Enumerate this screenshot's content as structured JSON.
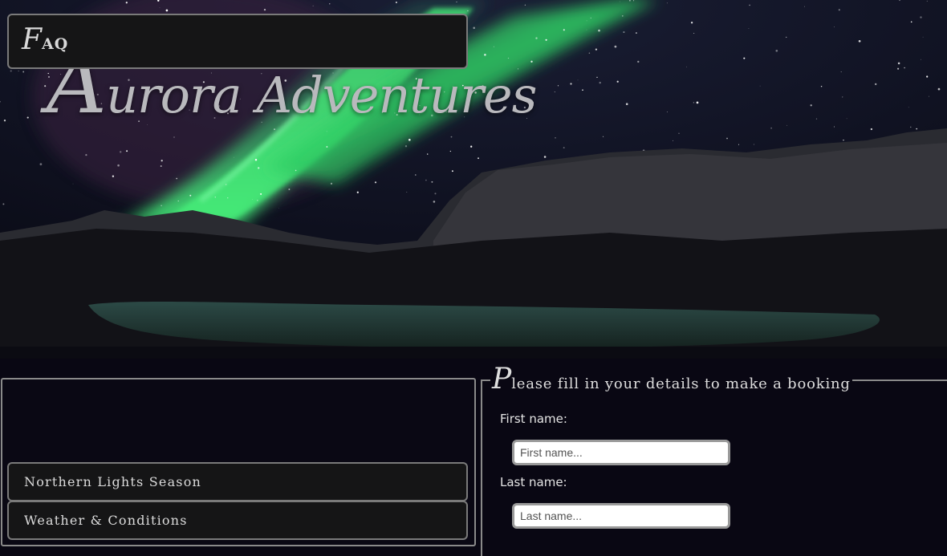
{
  "site": {
    "title_cap": "A",
    "title_rest": "urora Adventures"
  },
  "colors": {
    "page_bg": "#090713",
    "panel_bg": "#151516",
    "border": "#8a8a8a",
    "aurora": "#3be46f"
  },
  "faq": {
    "title_cap": "F",
    "title_rest": "AQ",
    "items": [
      {
        "label": "Northern Lights Season"
      },
      {
        "label": "Weather & Conditions"
      }
    ]
  },
  "booking": {
    "legend_cap": "P",
    "legend_rest": "lease fill in your details to make a booking",
    "fields": [
      {
        "label": "First name:",
        "placeholder": "First name...",
        "value": ""
      },
      {
        "label": "Last name:",
        "placeholder": "Last name...",
        "value": ""
      }
    ]
  }
}
